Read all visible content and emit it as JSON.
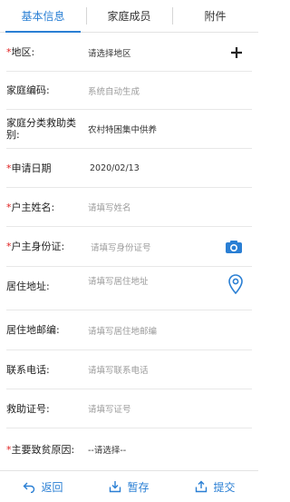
{
  "tabs": [
    {
      "label": "基本信息",
      "active": true
    },
    {
      "label": "家庭成员",
      "active": false
    },
    {
      "label": "附件",
      "active": false
    }
  ],
  "form": {
    "district": {
      "required": "*",
      "label": "地区:",
      "placeholder": "请选择地区",
      "icon": "plus-icon"
    },
    "family_code": {
      "label": "家庭编码:",
      "placeholder": "系统自动生成"
    },
    "category": {
      "label": "家庭分类救助类别:",
      "value": "农村特困集中供养"
    },
    "apply_date": {
      "required": "*",
      "label": "申请日期",
      "value": "2020/02/13"
    },
    "head_name": {
      "required": "*",
      "label": "户主姓名:",
      "placeholder": "请填写姓名"
    },
    "head_id": {
      "required": "*",
      "label": "户主身份证:",
      "placeholder": "请填写身份证号",
      "icon": "camera-icon"
    },
    "address": {
      "label": "居住地址:",
      "placeholder": "请填写居住地址",
      "icon": "location-pin-icon"
    },
    "postcode": {
      "label": "居住地邮编:",
      "placeholder": "请填写居住地邮编"
    },
    "phone": {
      "label": "联系电话:",
      "placeholder": "请填写联系电话"
    },
    "aid_no": {
      "label": "救助证号:",
      "placeholder": "请填写证号"
    },
    "poverty_cause": {
      "required": "*",
      "label": "主要致贫原因:",
      "value": "--请选择--"
    }
  },
  "bottom": {
    "back": "返回",
    "save": "暂存",
    "submit": "提交"
  },
  "colors": {
    "accent": "#2a7fd4",
    "required": "#e02020"
  }
}
